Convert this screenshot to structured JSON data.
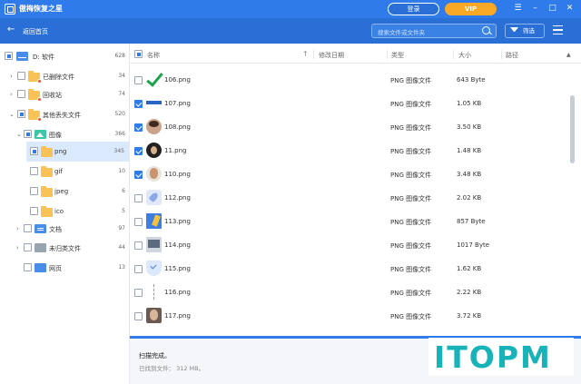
{
  "app": {
    "title": "傲梅恢复之星",
    "login_label": "登录",
    "vip_label": "VIP",
    "colors": {
      "primary": "#2f7be9",
      "vip": "#f9a825",
      "selected": "#dbe9fc"
    }
  },
  "toolbar": {
    "back_label": "返回首页",
    "search_placeholder": "搜索文件或文件夹",
    "filter_label": "筛选"
  },
  "sidebar": {
    "items": [
      {
        "label": "D: 软件",
        "count": "628"
      },
      {
        "label": "已删除文件",
        "count": "34"
      },
      {
        "label": "回收站",
        "count": "74"
      },
      {
        "label": "其他丢失文件",
        "count": "520"
      },
      {
        "label": "图像",
        "count": "366"
      },
      {
        "label": "png",
        "count": "345"
      },
      {
        "label": "gif",
        "count": "10"
      },
      {
        "label": "jpeg",
        "count": "6"
      },
      {
        "label": "ico",
        "count": "5"
      },
      {
        "label": "文档",
        "count": "97"
      },
      {
        "label": "未归类文件",
        "count": "44"
      },
      {
        "label": "网页",
        "count": "13"
      }
    ]
  },
  "table": {
    "columns": {
      "name": "名称",
      "modified": "修改日期",
      "type": "类型",
      "size": "大小",
      "path": "路径"
    },
    "rows": [
      {
        "name": "106.png",
        "type": "PNG 图像文件",
        "size": "643 Byte",
        "checked": false,
        "thumb": "checkmark-thumbnail"
      },
      {
        "name": "107.png",
        "type": "PNG 图像文件",
        "size": "1.05 KB",
        "checked": true,
        "thumb": "blue-bar-thumbnail"
      },
      {
        "name": "108.png",
        "type": "PNG 图像文件",
        "size": "3.50 KB",
        "checked": true,
        "thumb": "avatar-thumbnail"
      },
      {
        "name": "11.png",
        "type": "PNG 图像文件",
        "size": "1.48 KB",
        "checked": true,
        "thumb": "avatar-thumbnail"
      },
      {
        "name": "110.png",
        "type": "PNG 图像文件",
        "size": "3.48 KB",
        "checked": true,
        "thumb": "avatar-thumbnail"
      },
      {
        "name": "112.png",
        "type": "PNG 图像文件",
        "size": "2.02 KB",
        "checked": false,
        "thumb": "rocket-thumbnail"
      },
      {
        "name": "113.png",
        "type": "PNG 图像文件",
        "size": "857 Byte",
        "checked": false,
        "thumb": "notebook-thumbnail"
      },
      {
        "name": "114.png",
        "type": "PNG 图像文件",
        "size": "1017 Byte",
        "checked": false,
        "thumb": "laptop-thumbnail"
      },
      {
        "name": "115.png",
        "type": "PNG 图像文件",
        "size": "1.62 KB",
        "checked": false,
        "thumb": "shield-thumbnail"
      },
      {
        "name": "116.png",
        "type": "PNG 图像文件",
        "size": "2.22 KB",
        "checked": false,
        "thumb": "dotted-line-thumbnail"
      },
      {
        "name": "117.png",
        "type": "PNG 图像文件",
        "size": "3.72 KB",
        "checked": false,
        "thumb": "avatar-thumbnail"
      }
    ]
  },
  "status": {
    "title": "扫描完成。",
    "found_text": "已找到文件： 312 MB。"
  },
  "watermark": {
    "text": "ITOPM"
  }
}
